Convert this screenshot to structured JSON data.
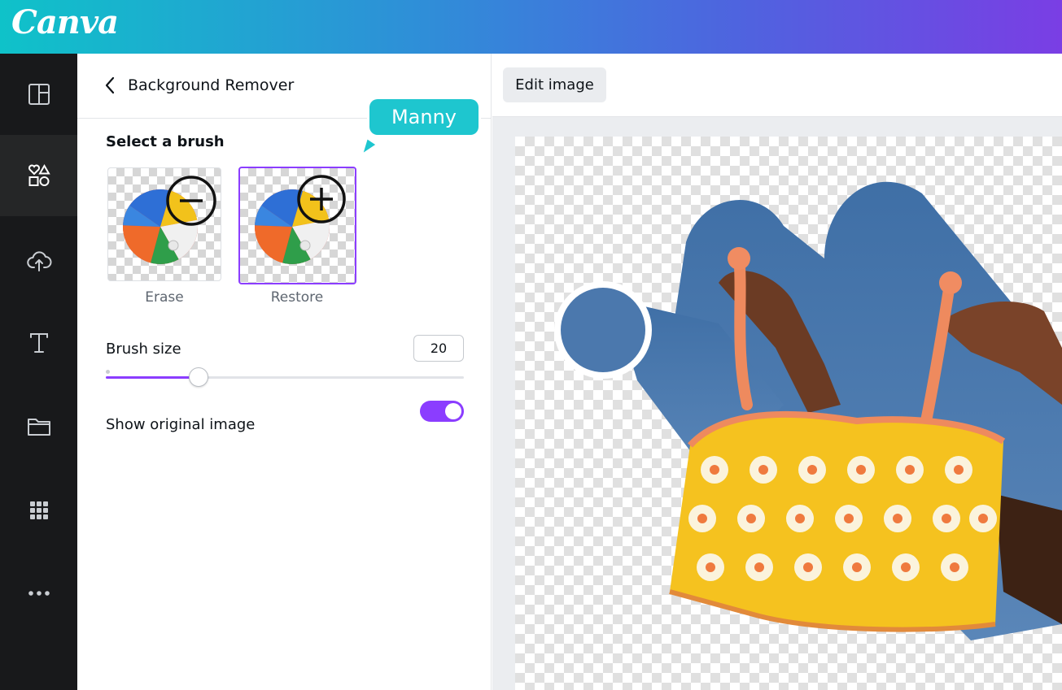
{
  "app": {
    "logo_text": "Canva",
    "brand_gradient": [
      "#0fc2c9",
      "#7a3ee4"
    ]
  },
  "rail": {
    "items": [
      {
        "icon": "layout-icon"
      },
      {
        "icon": "elements-icon",
        "active": true
      },
      {
        "icon": "upload-cloud-icon"
      },
      {
        "icon": "text-icon"
      },
      {
        "icon": "folder-icon"
      },
      {
        "icon": "apps-grid-icon"
      },
      {
        "icon": "more-icon"
      }
    ]
  },
  "panel": {
    "title": "Background Remover",
    "select_brush_label": "Select a brush",
    "brushes": [
      {
        "label": "Erase",
        "icon": "minus-circle-icon",
        "selected": false
      },
      {
        "label": "Restore",
        "icon": "plus-circle-icon",
        "selected": true
      }
    ],
    "brush_size": {
      "label": "Brush size",
      "value": "20",
      "slider_fraction": 0.26
    },
    "show_original": {
      "label": "Show original image",
      "enabled": true
    },
    "accent_color": "#8b3dff"
  },
  "collaborator": {
    "name": "Manny",
    "color": "#1ec6cf"
  },
  "editor": {
    "edit_image_label": "Edit image"
  }
}
